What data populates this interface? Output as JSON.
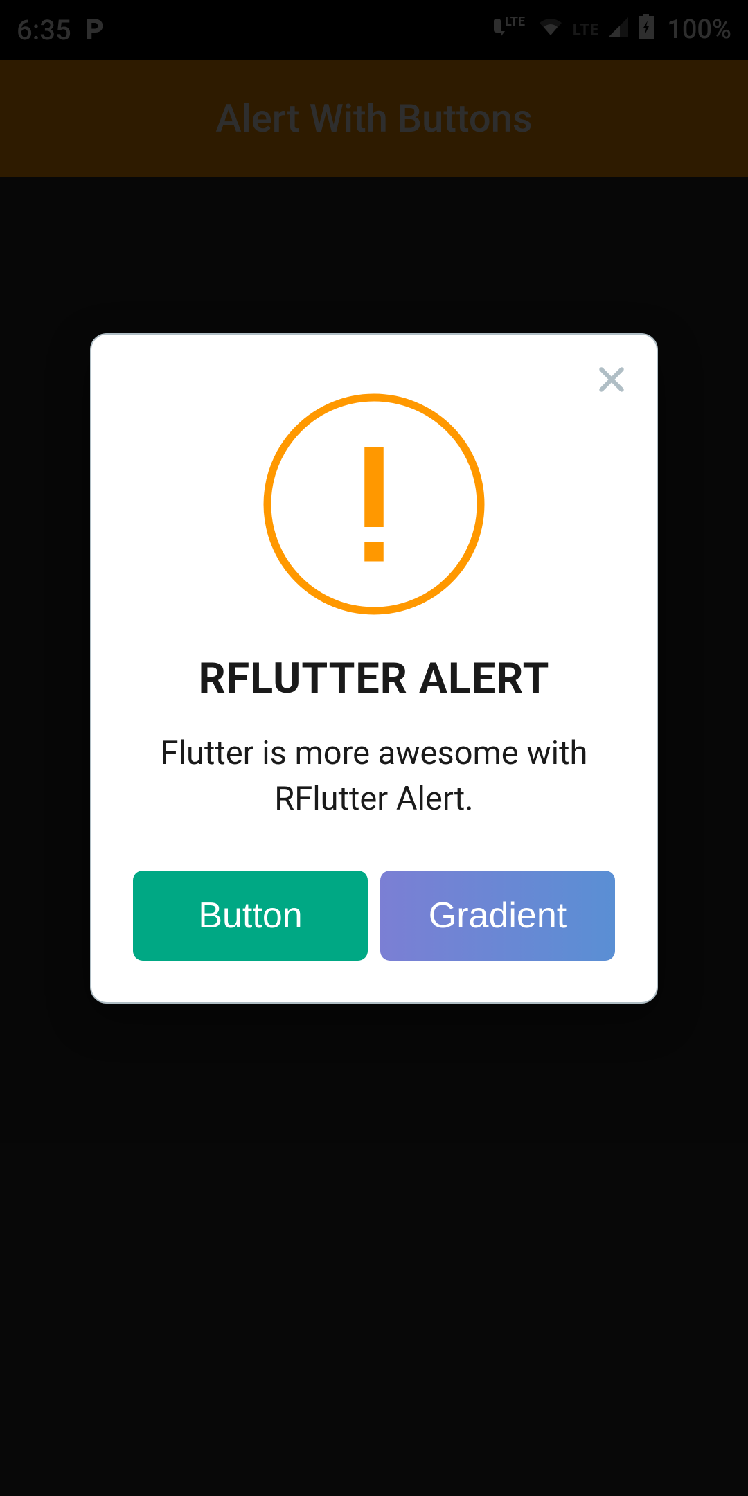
{
  "status_bar": {
    "time": "6:35",
    "battery": "100%",
    "lte_label": "LTE"
  },
  "app_bar": {
    "title": "Alert With Buttons"
  },
  "dialog": {
    "title": "RFLUTTER ALERT",
    "message": "Flutter is more awesome with RFlutter Alert.",
    "buttons": {
      "primary": "Button",
      "gradient": "Gradient"
    }
  }
}
